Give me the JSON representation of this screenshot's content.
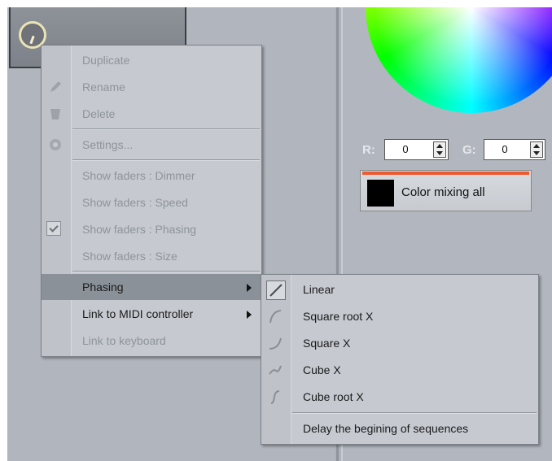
{
  "context_menu": {
    "items": [
      {
        "label": "Duplicate",
        "enabled": false
      },
      {
        "label": "Rename",
        "enabled": false,
        "icon": "pencil-icon"
      },
      {
        "label": "Delete",
        "enabled": false,
        "icon": "trash-icon"
      },
      {
        "label": "Settings...",
        "enabled": false,
        "icon": "gear-icon"
      },
      {
        "label": "Show faders : Dimmer",
        "enabled": false
      },
      {
        "label": "Show faders : Speed",
        "enabled": false
      },
      {
        "label": "Show faders : Phasing",
        "enabled": false,
        "checked": true
      },
      {
        "label": "Show faders : Size",
        "enabled": false
      },
      {
        "label": "Phasing",
        "enabled": true,
        "highlighted": true,
        "submenu": true
      },
      {
        "label": "Link to MIDI controller",
        "enabled": true,
        "submenu": true
      },
      {
        "label": "Link to keyboard",
        "enabled": false
      }
    ]
  },
  "phasing_submenu": {
    "items": [
      {
        "label": "Linear",
        "icon": "linear-curve-icon",
        "selected": true
      },
      {
        "label": "Square root X",
        "icon": "square-root-curve-icon"
      },
      {
        "label": "Square X",
        "icon": "square-curve-icon"
      },
      {
        "label": "Cube X",
        "icon": "cube-curve-icon"
      },
      {
        "label": "Cube root X",
        "icon": "cube-root-curve-icon"
      },
      {
        "label": "Delay the begining of sequences"
      }
    ]
  },
  "color_panel": {
    "r_label": "R:",
    "r_value": "0",
    "g_label": "G:",
    "g_value": "0",
    "color_mixing_label": "Color mixing all",
    "swatch_color": "#000000",
    "accent_color": "#ec5a30"
  }
}
